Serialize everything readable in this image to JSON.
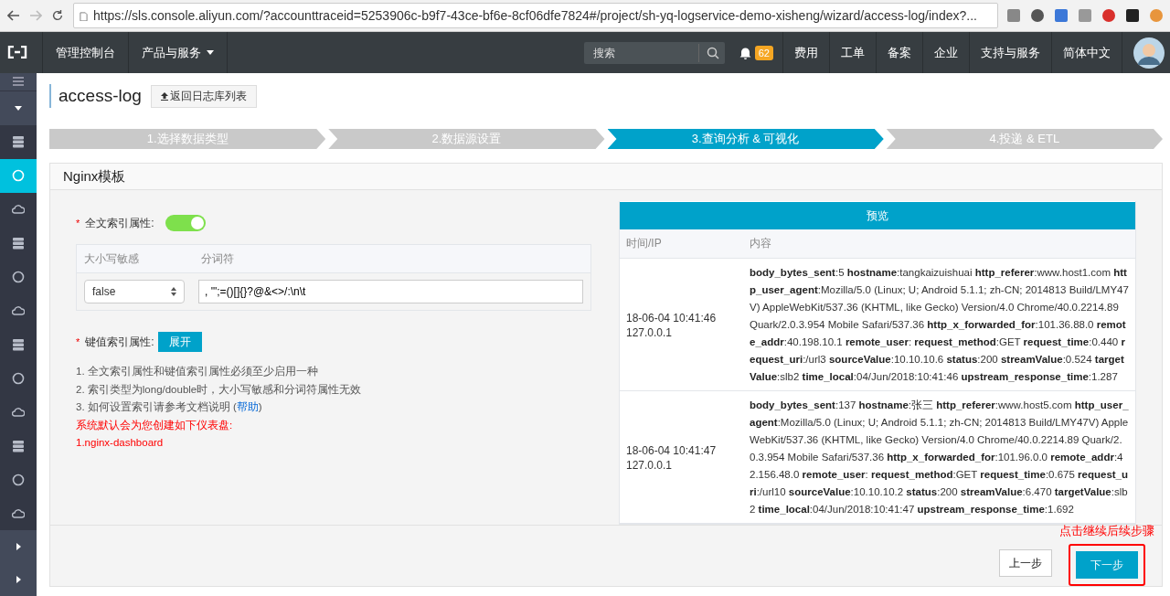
{
  "browser": {
    "url": "https://sls.console.aliyun.com/?accounttraceid=5253906c-b9f7-43ce-bf6e-8cf06dfe7824#/project/sh-yq-logservice-demo-xisheng/wizard/access-log/index?..."
  },
  "topnav": {
    "console": "管理控制台",
    "products": "产品与服务",
    "search_placeholder": "搜索",
    "notifications": "62",
    "links": [
      "费用",
      "工单",
      "备案",
      "企业",
      "支持与服务",
      "简体中文"
    ]
  },
  "sidebar": {
    "items": [
      {
        "selected": false
      },
      {
        "selected": true
      },
      {
        "selected": false
      },
      {
        "selected": false
      },
      {
        "selected": false
      },
      {
        "selected": false
      },
      {
        "selected": false
      },
      {
        "selected": false
      },
      {
        "selected": false
      },
      {
        "selected": false
      },
      {
        "selected": false
      },
      {
        "selected": false
      }
    ]
  },
  "page": {
    "title": "access-log",
    "back_button": "返回日志库列表"
  },
  "steps": [
    {
      "label": "1.选择数据类型",
      "selected": false
    },
    {
      "label": "2.数据源设置",
      "selected": false
    },
    {
      "label": "3.查询分析 & 可视化",
      "selected": true
    },
    {
      "label": "4.投递 & ETL",
      "selected": false
    }
  ],
  "card": {
    "title": "Nginx模板"
  },
  "fulltext": {
    "required": "*",
    "label": "全文索引属性:",
    "on": true,
    "columns": [
      "大小写敏感",
      "分词符"
    ],
    "case_sensitive": "false",
    "delimiters": ", '\";=()[]{}?@&<>/:\\n\\t"
  },
  "keyvalue": {
    "required": "*",
    "label": "键值索引属性:",
    "button": "展开"
  },
  "notes": [
    "1. 全文索引属性和键值索引属性必须至少启用一种",
    "2. 索引类型为long/double时，大小写敏感和分词符属性无效"
  ],
  "help_note": {
    "text": "3. 如何设置索引请参考文档说明 (",
    "link": "帮助",
    "end": ")"
  },
  "warnings": [
    "系统默认会为您创建如下仪表盘:",
    "1.nginx-dashboard"
  ],
  "preview": {
    "title": "预览",
    "columns": [
      "时间/IP",
      "内容"
    ],
    "rows": [
      {
        "time": "18-06-04 10:41:46",
        "ip": "127.0.0.1",
        "content": "**body_bytes_sent**:5  **hostname**:tangkaizuishuai  **http_referer**:www.host1.com  **http_user_agent**:Mozilla/5.0 (Linux; U; Android 5.1.1; zh-CN; 2014813 Build/LMY47V) AppleWebKit/537.36 (KHTML, like Gecko) Version/4.0 Chrome/40.0.2214.89 Quark/2.0.3.954 Mobile Safari/537.36  **http_x_forwarded_for**:101.36.88.0  **remote_addr**:40.198.10.1  **remote_user**:  **request_method**:GET  **request_time**:0.440  **request_uri**:/url3  **sourceValue**:10.10.10.6  **status**:200  **streamValue**:0.524  **targetValue**:slb2  **time_local**:04/Jun/2018:10:41:46  **upstream_response_time**:1.287"
      },
      {
        "time": "18-06-04 10:41:47",
        "ip": "127.0.0.1",
        "content": "**body_bytes_sent**:137  **hostname**:张三  **http_referer**:www.host5.com  **http_user_agent**:Mozilla/5.0 (Linux; U; Android 5.1.1; zh-CN; 2014813 Build/LMY47V) AppleWebKit/537.36 (KHTML, like Gecko) Version/4.0 Chrome/40.0.2214.89 Quark/2.0.3.954 Mobile Safari/537.36  **http_x_forwarded_for**:101.96.0.0  **remote_addr**:42.156.48.0  **remote_user**:  **request_method**:GET  **request_time**:0.675  **request_uri**:/url10  **sourceValue**:10.10.10.2  **status**:200  **streamValue**:6.470  **targetValue**:slb2  **time_local**:04/Jun/2018:10:41:47  **upstream_response_time**:1.692"
      }
    ]
  },
  "footer": {
    "prev": "上一步",
    "next": "下一步",
    "annotation": "点击继续后续步骤"
  }
}
